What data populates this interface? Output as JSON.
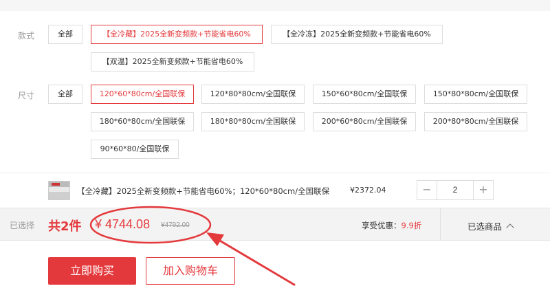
{
  "style_row": {
    "label": "款式",
    "options": [
      {
        "text": "全部",
        "selected": false
      },
      {
        "text": "【全冷藏】2025全新变频款+节能省电60%",
        "selected": true
      },
      {
        "text": "【全冷冻】2025全新变频款+节能省电60%",
        "selected": false
      },
      {
        "text": "【双温】2025全新变频款+节能省电60%",
        "selected": false
      }
    ]
  },
  "size_row": {
    "label": "尺寸",
    "options": [
      {
        "text": "全部",
        "selected": false
      },
      {
        "text": "120*60*80cm/全国联保",
        "selected": true
      },
      {
        "text": "120*80*80cm/全国联保",
        "selected": false
      },
      {
        "text": "150*60*80cm/全国联保",
        "selected": false
      },
      {
        "text": "150*80*80cm/全国联保",
        "selected": false
      },
      {
        "text": "180*60*80cm/全国联保",
        "selected": false
      },
      {
        "text": "180*80*80cm/全国联保",
        "selected": false
      },
      {
        "text": "200*60*80cm/全国联保",
        "selected": false
      },
      {
        "text": "200*80*80cm/全国联保",
        "selected": false
      },
      {
        "text": "90*60*80/全国联保",
        "selected": false
      }
    ]
  },
  "selected_item": {
    "name": "【全冷藏】2025全新变频款+节能省电60%；120*60*80cm/全国联保",
    "price": "¥2372.04",
    "quantity": "2",
    "minus": "−",
    "plus": "+"
  },
  "summary": {
    "label": "已选择",
    "count": "共2件",
    "total": "¥ 4744.08",
    "original": "¥4792.00",
    "discount_label": "享受优惠：",
    "discount_value": "9.9折",
    "selected_goods": "已选商品"
  },
  "actions": {
    "buy_now": "立即购买",
    "add_to_cart": "加入购物车"
  },
  "colors": {
    "accent": "#e4393c",
    "annotation": "#e4393c"
  }
}
